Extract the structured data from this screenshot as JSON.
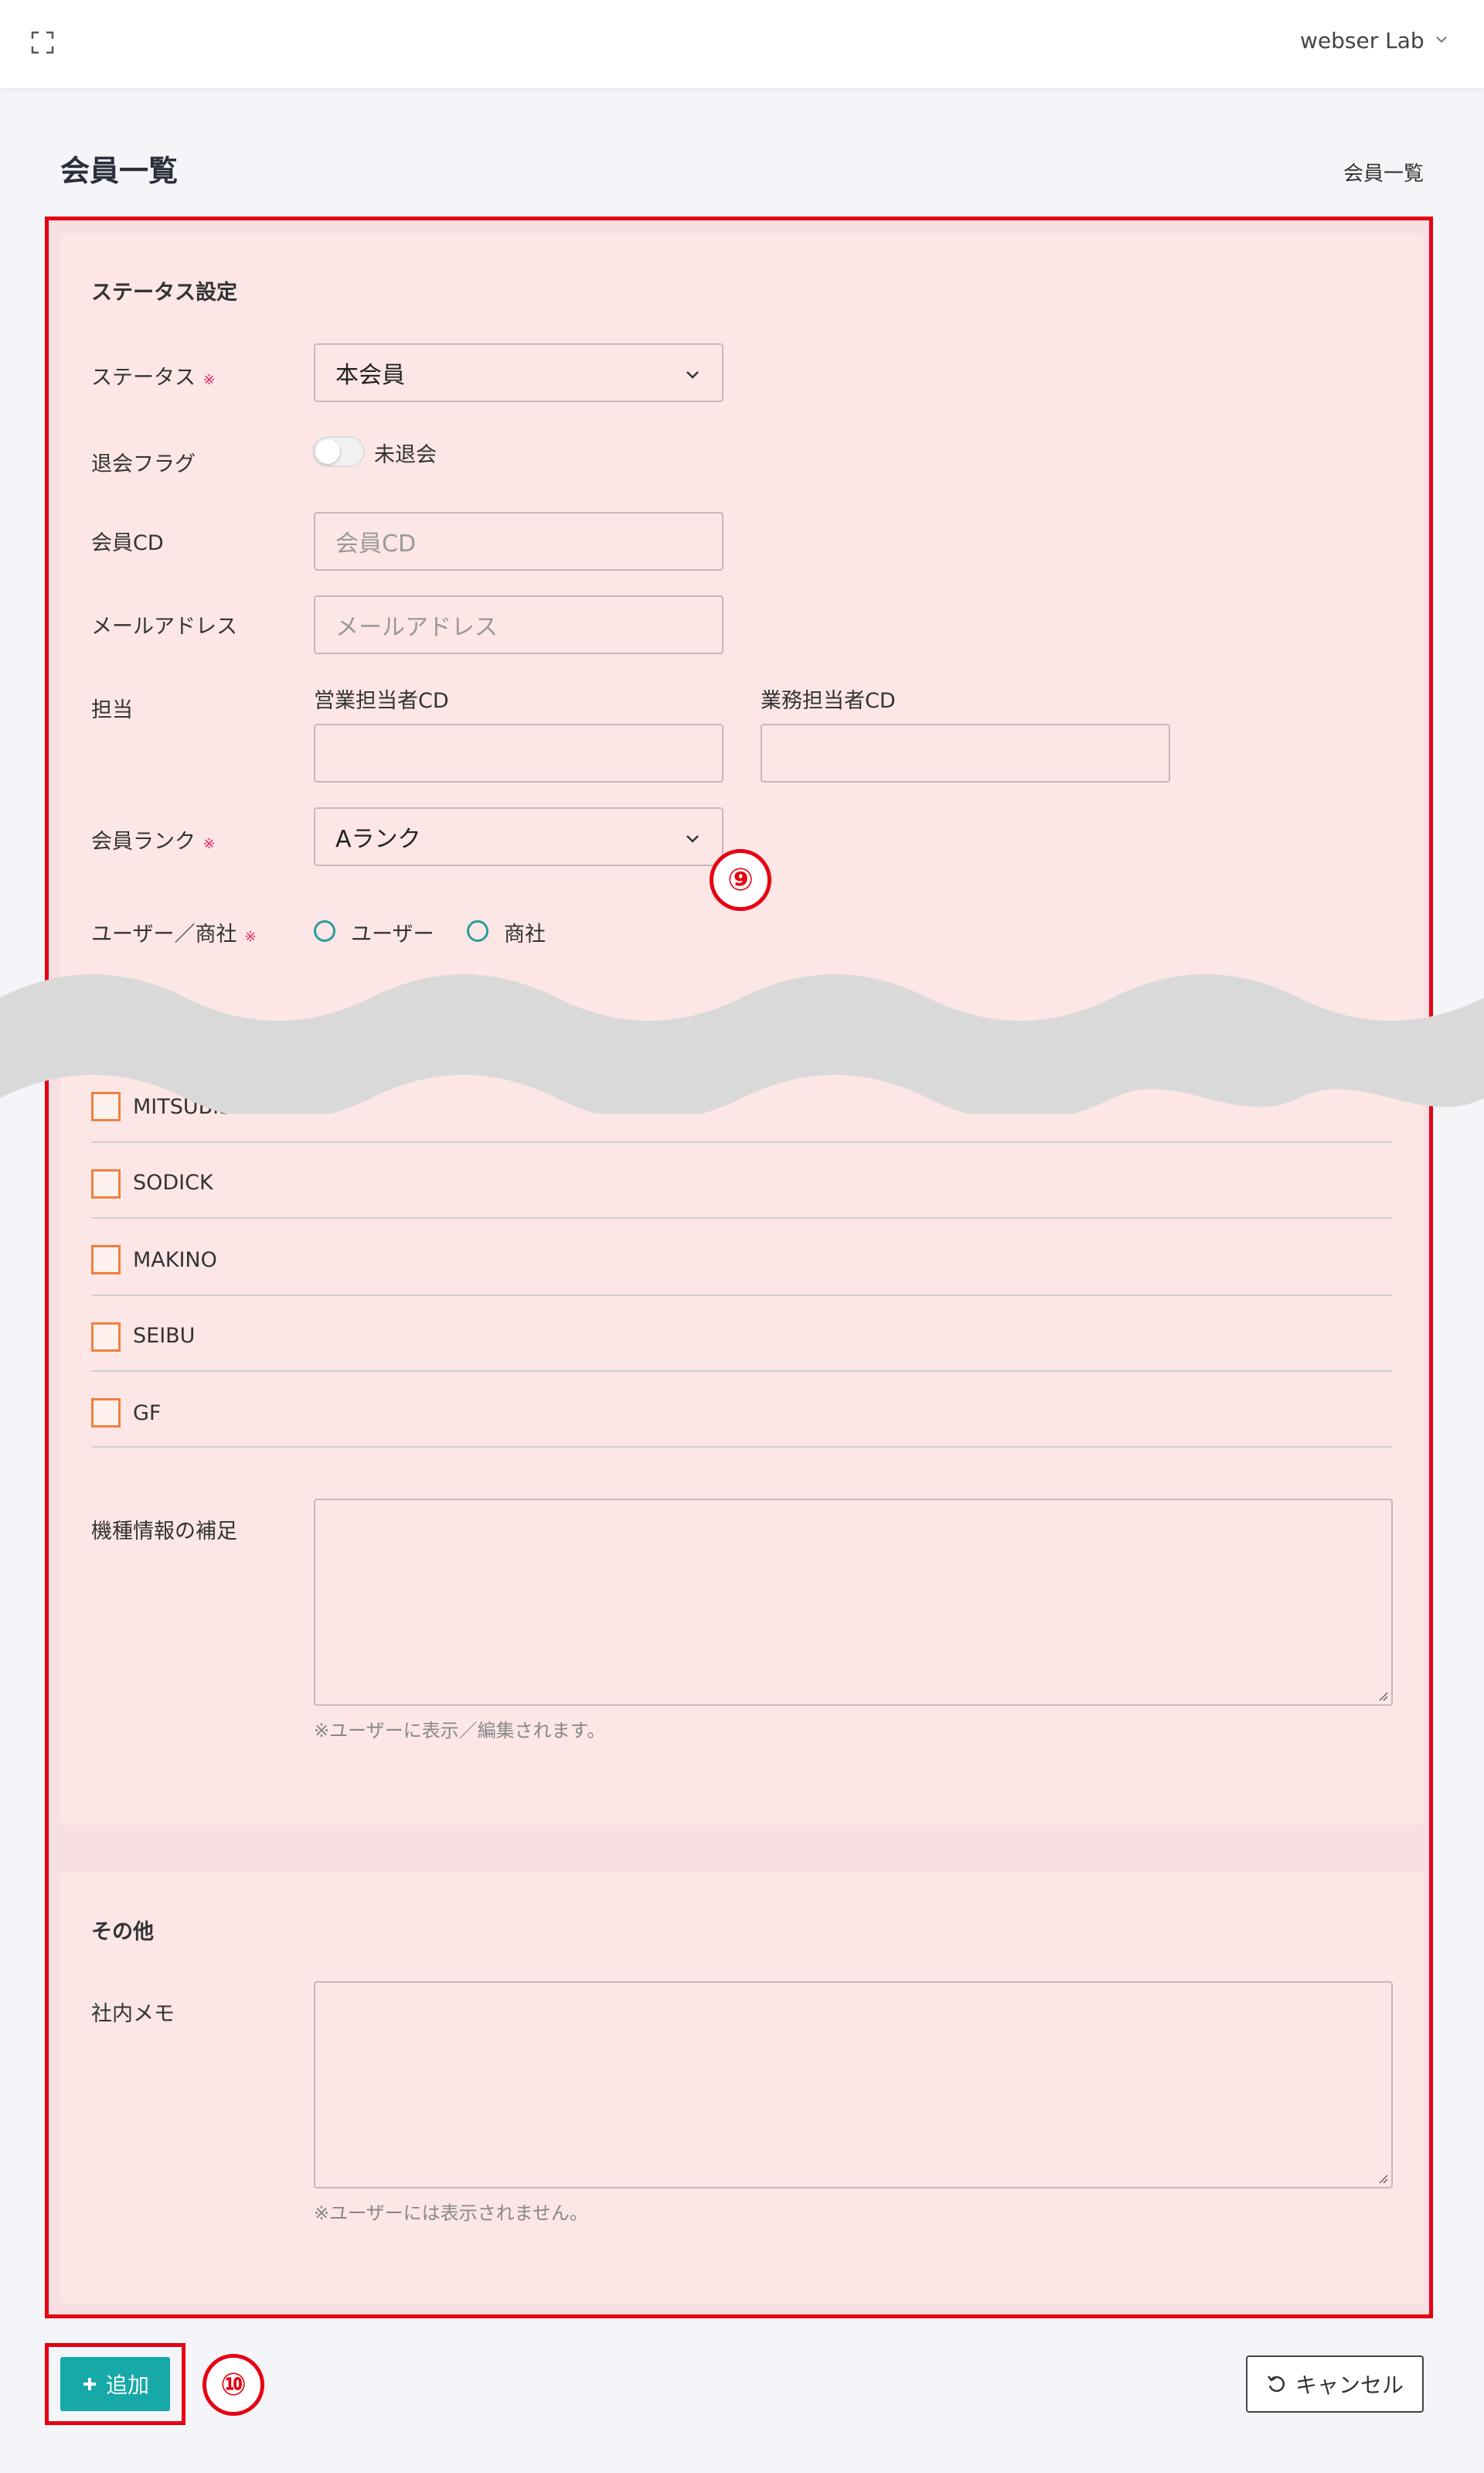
{
  "topbar": {
    "user_name": "webser Lab"
  },
  "page": {
    "title": "会員一覧",
    "breadcrumb": "会員一覧"
  },
  "status_section": {
    "title": "ステータス設定",
    "status": {
      "label": "ステータス",
      "required_mark": "※",
      "selected": "本会員"
    },
    "withdrawal_flag": {
      "label": "退会フラグ",
      "toggle_text": "未退会"
    },
    "member_cd": {
      "label": "会員CD",
      "placeholder": "会員CD"
    },
    "email": {
      "label": "メールアドレス",
      "placeholder": "メールアドレス"
    },
    "staff": {
      "label": "担当",
      "sales_label": "営業担当者CD",
      "ops_label": "業務担当者CD"
    },
    "rank": {
      "label": "会員ランク",
      "required_mark": "※",
      "selected": "Aランク"
    },
    "user_type": {
      "label": "ユーザー／商社",
      "required_mark": "※",
      "options": [
        "ユーザー",
        "商社"
      ]
    },
    "makers": [
      "MITSUBISHI",
      "SODICK",
      "MAKINO",
      "SEIBU",
      "GF"
    ],
    "model_note": {
      "label": "機種情報の補足",
      "help": "※ユーザーに表示／編集されます。"
    }
  },
  "other_section": {
    "title": "その他",
    "memo": {
      "label": "社内メモ",
      "help": "※ユーザーには表示されません。"
    }
  },
  "markers": {
    "nine": "⑨",
    "ten": "⑩"
  },
  "actions": {
    "add_label": "追加",
    "cancel_label": "キャンセル"
  },
  "colors": {
    "highlight": "#e60012",
    "accent": "#16a9a8",
    "required": "#e0245e",
    "checkbox": "#f08040",
    "radio": "#2a9d9b"
  }
}
